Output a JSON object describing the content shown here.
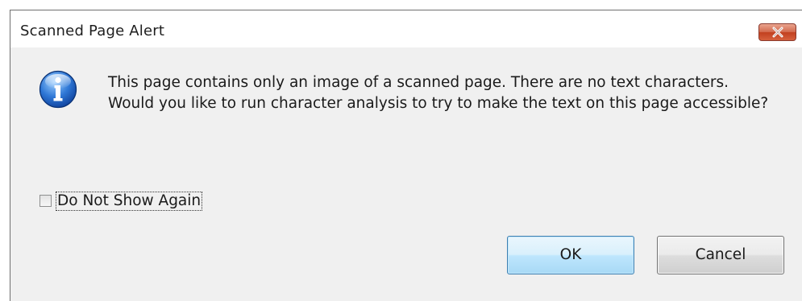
{
  "dialog": {
    "title": "Scanned Page Alert",
    "icon": "info-icon",
    "message": "This page contains only an image of a scanned page. There are no text characters. Would you like to run character analysis to try to make the text on this page accessible?",
    "checkbox": {
      "label": "Do Not Show Again",
      "checked": false
    },
    "buttons": {
      "ok_label": "OK",
      "cancel_label": "Cancel"
    }
  },
  "colors": {
    "dialog_background": "#f0f0f0",
    "close_button": "#c7452a",
    "ok_button": "#bee6fd"
  }
}
